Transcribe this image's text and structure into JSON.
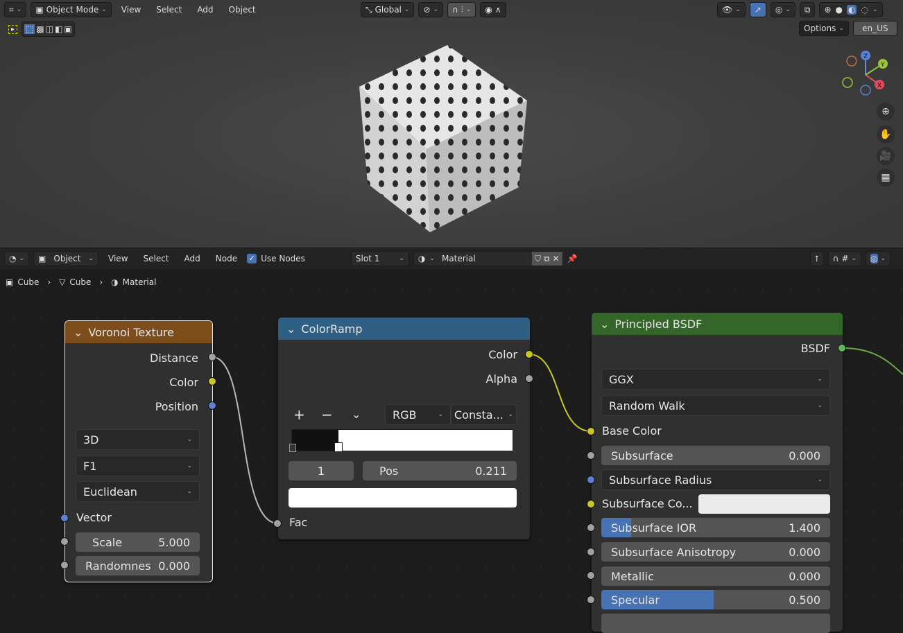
{
  "viewport_header": {
    "mode": "Object Mode",
    "menus": [
      "View",
      "Select",
      "Add",
      "Object"
    ],
    "orientation": "Global",
    "options": "Options",
    "locale": "en_US"
  },
  "gizmo": {
    "z": "Z",
    "x": "X",
    "y": "Y"
  },
  "node_header": {
    "editor_type": "Object",
    "menus": [
      "View",
      "Select",
      "Add",
      "Node"
    ],
    "use_nodes_label": "Use Nodes",
    "use_nodes": true,
    "slot": "Slot 1",
    "material": "Material"
  },
  "breadcrumb": [
    "Cube",
    "Cube",
    "Material"
  ],
  "voronoi": {
    "title": "Voronoi Texture",
    "outputs": [
      "Distance",
      "Color",
      "Position"
    ],
    "dims": "3D",
    "feature": "F1",
    "metric": "Euclidean",
    "vector_label": "Vector",
    "scale_label": "Scale",
    "scale": "5.000",
    "random_label": "Randomnes",
    "random": "0.000"
  },
  "colorramp": {
    "title": "ColorRamp",
    "outputs": [
      "Color",
      "Alpha"
    ],
    "plus": "+",
    "minus": "−",
    "mode": "RGB",
    "interp": "Consta...",
    "index": "1",
    "pos_label": "Pos",
    "pos": "0.211",
    "pos_value": 0.211,
    "fac_label": "Fac"
  },
  "bsdf": {
    "title": "Principled BSDF",
    "output": "BSDF",
    "distribution": "GGX",
    "subsurface_method": "Random Walk",
    "base_color": "Base Color",
    "fields": [
      {
        "label": "Subsurface",
        "value": "0.000",
        "fraction": 0
      },
      {
        "label": "Subsurface IOR",
        "value": "1.400",
        "fraction": 0.14
      },
      {
        "label": "Subsurface Anisotropy",
        "value": "0.000",
        "fraction": 0
      },
      {
        "label": "Metallic",
        "value": "0.000",
        "fraction": 0
      },
      {
        "label": "Specular",
        "value": "0.500",
        "fraction": 0.5
      }
    ],
    "subsurface_radius": "Subsurface Radius",
    "subsurface_color": "Subsurface Co..."
  },
  "colors": {
    "voronoi_header": "#7d4d1c",
    "colorramp_header": "#2f5f82",
    "bsdf_header": "#336628",
    "accent": "#4772b3"
  }
}
